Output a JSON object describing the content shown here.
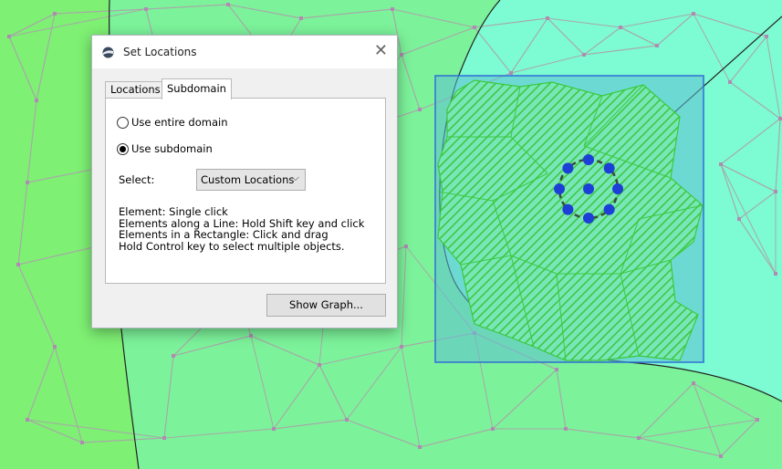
{
  "dialog": {
    "title": "Set Locations",
    "close_glyph": "✕",
    "tabs": [
      {
        "label": "Locations",
        "active": false
      },
      {
        "label": "Subdomain",
        "active": true
      }
    ],
    "options": {
      "entire_domain": "Use entire domain",
      "subdomain": "Use subdomain",
      "selected": "subdomain"
    },
    "select_label": "Select:",
    "select_value": "Custom Locations",
    "instructions": [
      "Element: Single click",
      "Elements along a Line: Hold Shift key and click",
      "Elements in a Rectangle: Click and drag",
      "Hold Control key to select multiple objects."
    ],
    "show_graph_label": "Show Graph..."
  },
  "colors": {
    "background_outer": "#7cf29a",
    "background_inner": "#7dfbd2",
    "left_region": "#7ef073",
    "selection_rect_fill": "#5fbfd4",
    "selection_rect_border": "#2f6fd3",
    "hatch": "#3cc93e",
    "mesh_edge": "#a8a8a8",
    "node": "#1c3fd6"
  },
  "map": {
    "mesh": "triangular-mesh",
    "selected_elements": "hatched-subdomain",
    "marker_nodes": 9
  }
}
